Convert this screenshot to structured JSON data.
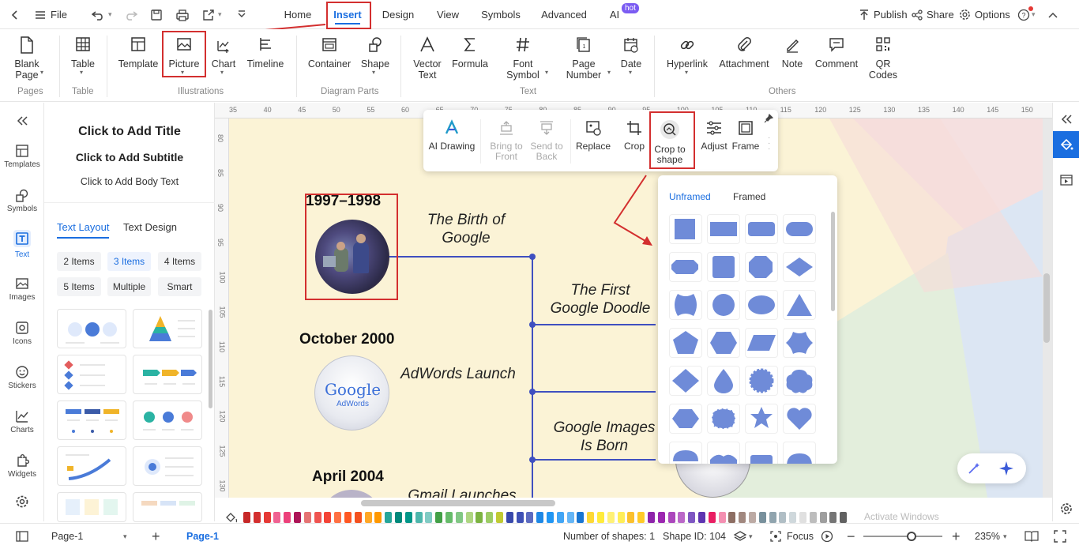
{
  "titlebar": {
    "file_label": "File",
    "tabs": [
      "Home",
      "Insert",
      "Design",
      "View",
      "Symbols",
      "Advanced",
      "AI"
    ],
    "active_tab": "Insert",
    "hot_badge": "hot",
    "publish": "Publish",
    "share": "Share",
    "options": "Options"
  },
  "ribbon": {
    "buttons": {
      "blank_page": "Blank\nPage",
      "table": "Table",
      "template": "Template",
      "picture": "Picture",
      "chart": "Chart",
      "timeline": "Timeline",
      "container": "Container",
      "shape": "Shape",
      "vector_text": "Vector\nText",
      "formula": "Formula",
      "font_symbol": "Font\nSymbol",
      "page_number": "Page\nNumber",
      "date": "Date",
      "hyperlink": "Hyperlink",
      "attachment": "Attachment",
      "note": "Note",
      "comment": "Comment",
      "qr_codes": "QR\nCodes"
    },
    "groups": {
      "pages": "Pages",
      "table": "Table",
      "illustrations": "Illustrations",
      "diagram_parts": "Diagram Parts",
      "text": "Text",
      "others": "Others"
    }
  },
  "rail": {
    "items": [
      "Templates",
      "Symbols",
      "Text",
      "Images",
      "Icons",
      "Stickers",
      "Charts",
      "Widgets"
    ],
    "active": "Text"
  },
  "text_panel": {
    "title": "Click to Add Title",
    "subtitle": "Click to Add Subtitle",
    "body": "Click to Add Body Text",
    "tabs": [
      "Text Layout",
      "Text Design"
    ],
    "chips": [
      "2 Items",
      "3 Items",
      "4 Items",
      "5 Items",
      "Multiple",
      "Smart"
    ],
    "active_chip": "3 Items"
  },
  "ruler": {
    "top": [
      "35",
      "40",
      "45",
      "50",
      "55",
      "60",
      "65",
      "70",
      "75",
      "80",
      "85",
      "90",
      "95",
      "100",
      "105",
      "110",
      "115",
      "120",
      "125",
      "130",
      "135",
      "140",
      "145",
      "150"
    ],
    "left": [
      "80",
      "85",
      "90",
      "95",
      "100",
      "105",
      "110",
      "115",
      "120",
      "125",
      "130"
    ]
  },
  "timeline": {
    "years": [
      "1997–1998",
      "October 2000",
      "April 2004"
    ],
    "events": [
      "The Birth of\nGoogle",
      "The First\nGoogle Doodle",
      "AdWords Launch",
      "Google Images\nIs Born",
      "Gmail Launches"
    ],
    "adwords_logo": "Google",
    "adwords_sub": "AdWords"
  },
  "image_toolbar": {
    "items": [
      "AI Drawing",
      "Bring to\nFront",
      "Send to\nBack",
      "Replace",
      "Crop",
      "Crop to\nshape",
      "Adjust",
      "Frame"
    ]
  },
  "shapes_panel": {
    "tabs": [
      "Unframed",
      "Framed"
    ],
    "active_tab": "Unframed",
    "shape_color": "#6f8bd8"
  },
  "status": {
    "page_select": "Page-1",
    "page_tab": "Page-1",
    "num_shapes": "Number of shapes: 1",
    "shape_id": "Shape ID: 104",
    "focus": "Focus",
    "zoom": "235%",
    "watermark": "Activate Windows"
  },
  "palette_colors": [
    "#c62828",
    "#d32f2f",
    "#e53935",
    "#f06292",
    "#ec407a",
    "#ad1457",
    "#e57373",
    "#ef5350",
    "#f44336",
    "#ff7043",
    "#ff5722",
    "#f4511e",
    "#ffa726",
    "#ff9800",
    "#26a69a",
    "#00897b",
    "#009688",
    "#4db6ac",
    "#80cbc4",
    "#43a047",
    "#66bb6a",
    "#81c784",
    "#aed581",
    "#7cb342",
    "#9ccc65",
    "#c0ca33",
    "#3949ab",
    "#3f51b5",
    "#5c6bc0",
    "#1e88e5",
    "#2196f3",
    "#42a5f5",
    "#64b5f6",
    "#1976d2",
    "#fdd835",
    "#ffeb3b",
    "#fff176",
    "#ffee58",
    "#fbc02d",
    "#ffca28",
    "#8e24aa",
    "#9c27b0",
    "#ab47bc",
    "#ba68c8",
    "#7e57c2",
    "#5e35b1",
    "#e91e63",
    "#f48fb1",
    "#8d6e63",
    "#a1887f",
    "#bcaaa4",
    "#78909c",
    "#90a4ae",
    "#b0bec5",
    "#cfd8dc",
    "#e0e0e0",
    "#bdbdbd",
    "#9e9e9e",
    "#757575",
    "#616161"
  ]
}
